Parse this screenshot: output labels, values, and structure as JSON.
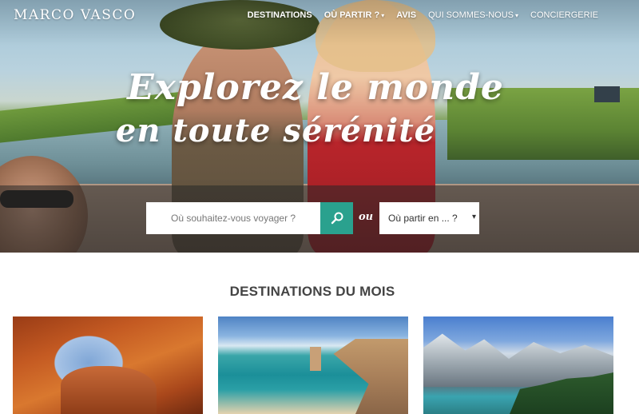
{
  "brand": {
    "logo_text": "MARCO VASCO"
  },
  "nav": {
    "items": [
      {
        "label": "DESTINATIONS",
        "caret": ""
      },
      {
        "label": "OÙ PARTIR ?",
        "caret": "▾"
      },
      {
        "label": "AVIS",
        "caret": ""
      },
      {
        "label": "QUI SOMMES-NOUS",
        "caret": "▾"
      },
      {
        "label": "CONCIERGERIE",
        "caret": ""
      }
    ]
  },
  "hero": {
    "headline_line1": "Explorez le monde",
    "headline_line2": "en toute sérénité"
  },
  "search": {
    "destination_placeholder": "Où souhaitez-vous voyager ?",
    "or_label": "ou",
    "date_select_value": "Où partir en ... ?",
    "date_select_arrow": "▾",
    "button_icon": "magnifier-icon"
  },
  "section": {
    "title": "DESTINATIONS DU MOIS",
    "cards": [
      {
        "image": "red-rock-arch-desert-photo"
      },
      {
        "image": "coastal-limestone-stacks-beach-photo"
      },
      {
        "image": "mountain-lake-forest-photo"
      }
    ]
  },
  "colors": {
    "accent_teal": "#2aa18e",
    "text_dark": "#444444",
    "white": "#ffffff"
  }
}
